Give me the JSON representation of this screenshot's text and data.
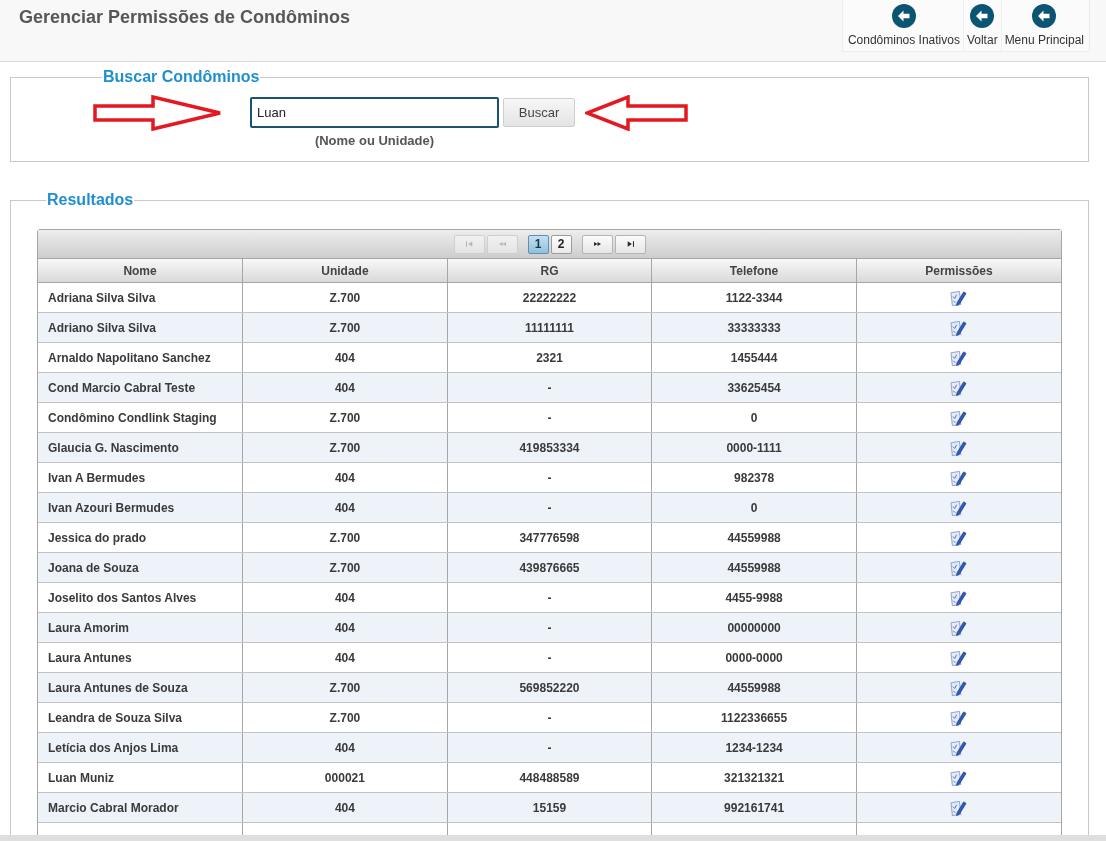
{
  "page": {
    "title": "Gerenciar Permissões de Condôminos"
  },
  "toolbar": [
    {
      "label": "Condôminos Inativos"
    },
    {
      "label": "Voltar"
    },
    {
      "label": "Menu Principal"
    }
  ],
  "search": {
    "legend": "Buscar Condôminos",
    "field": {
      "value": "Luan",
      "focused": true
    },
    "button": "Buscar",
    "hint": "(Nome ou Unidade)"
  },
  "results": {
    "legend": "Resultados",
    "pager": {
      "nav_start": [
        {
          "kind": "first",
          "disabled": true
        },
        {
          "kind": "prev",
          "disabled": true
        }
      ],
      "pages": [
        {
          "label": "1",
          "selected": true
        },
        {
          "label": "2",
          "selected": false
        }
      ],
      "nav_end": [
        {
          "kind": "next",
          "disabled": false
        },
        {
          "kind": "last",
          "disabled": false
        }
      ]
    },
    "table": {
      "columns": [
        "Nome",
        "Unidade",
        "RG",
        "Telefone",
        "Permissões"
      ],
      "rows": [
        {
          "nome": "Adriana Silva Silva",
          "unidade": "Z.700",
          "rg": "22222222",
          "telefone": "1122-3344"
        },
        {
          "nome": "Adriano Silva Silva",
          "unidade": "Z.700",
          "rg": "11111111",
          "telefone": "33333333"
        },
        {
          "nome": "Arnaldo Napolitano Sanchez",
          "unidade": "404",
          "rg": "2321",
          "telefone": "1455444"
        },
        {
          "nome": "Cond Marcio Cabral Teste",
          "unidade": "404",
          "rg": "-",
          "telefone": "33625454"
        },
        {
          "nome": "Condômino Condlink Staging",
          "unidade": "Z.700",
          "rg": "-",
          "telefone": "0"
        },
        {
          "nome": "Glaucia G. Nascimento",
          "unidade": "Z.700",
          "rg": "419853334",
          "telefone": "0000-1111"
        },
        {
          "nome": "Ivan A Bermudes",
          "unidade": "404",
          "rg": "-",
          "telefone": "982378"
        },
        {
          "nome": "Ivan Azouri Bermudes",
          "unidade": "404",
          "rg": "-",
          "telefone": "0"
        },
        {
          "nome": "Jessica do prado",
          "unidade": "Z.700",
          "rg": "347776598",
          "telefone": "44559988"
        },
        {
          "nome": "Joana de Souza",
          "unidade": "Z.700",
          "rg": "439876665",
          "telefone": "44559988"
        },
        {
          "nome": "Joselito dos Santos Alves",
          "unidade": "404",
          "rg": "-",
          "telefone": "4455-9988"
        },
        {
          "nome": "Laura Amorim",
          "unidade": "404",
          "rg": "-",
          "telefone": "00000000"
        },
        {
          "nome": "Laura Antunes",
          "unidade": "404",
          "rg": "-",
          "telefone": "0000-0000"
        },
        {
          "nome": "Laura Antunes de Souza",
          "unidade": "Z.700",
          "rg": "569852220",
          "telefone": "44559988"
        },
        {
          "nome": "Leandra de Souza Silva",
          "unidade": "Z.700",
          "rg": "-",
          "telefone": "1122336655"
        },
        {
          "nome": "Letícia dos Anjos Lima",
          "unidade": "404",
          "rg": "-",
          "telefone": "1234-1234"
        },
        {
          "nome": "Luan Muniz",
          "unidade": "000021",
          "rg": "448488589",
          "telefone": "321321321"
        },
        {
          "nome": "Marcio Cabral Morador",
          "unidade": "404",
          "rg": "15159",
          "telefone": "992161741"
        }
      ]
    }
  }
}
